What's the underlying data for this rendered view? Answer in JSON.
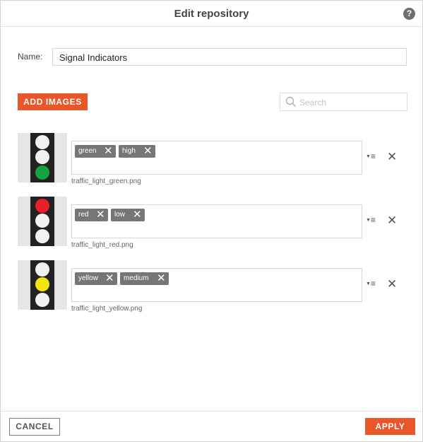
{
  "dialog": {
    "title": "Edit repository",
    "help_label": "?"
  },
  "name_field": {
    "label": "Name:",
    "value": "Signal Indicators"
  },
  "toolbar": {
    "add_images_label": "ADD IMAGES",
    "search_placeholder": "Search"
  },
  "images": [
    {
      "filename": "traffic_light_green.png",
      "tags": [
        "green",
        "high"
      ],
      "lamps": [
        "#f1f1f1",
        "#f1f1f1",
        "#12a33e"
      ]
    },
    {
      "filename": "traffic_light_red.png",
      "tags": [
        "red",
        "low"
      ],
      "lamps": [
        "#e8202a",
        "#f1f1f1",
        "#f1f1f1"
      ]
    },
    {
      "filename": "traffic_light_yellow.png",
      "tags": [
        "yellow",
        "medium"
      ],
      "lamps": [
        "#f1f1f1",
        "#f5e50e",
        "#f1f1f1"
      ]
    }
  ],
  "row_actions": {
    "menu_icon": "≡",
    "menu_arrow": "▼",
    "delete_icon": "✕",
    "tag_remove_icon": "✕"
  },
  "footer": {
    "cancel_label": "CANCEL",
    "apply_label": "APPLY"
  },
  "colors": {
    "accent": "#e8562a",
    "tag_bg": "#767676"
  }
}
